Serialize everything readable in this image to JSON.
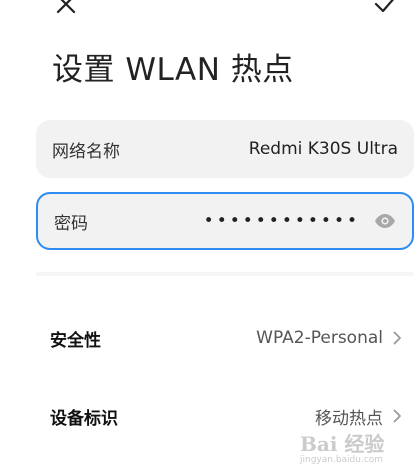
{
  "header": {
    "close_icon": "close-icon",
    "confirm_icon": "check-icon",
    "title": "设置 WLAN 热点"
  },
  "ssid": {
    "label": "网络名称",
    "value": "Redmi K30S Ultra"
  },
  "password": {
    "label": "密码",
    "value": "••••••••••••",
    "toggle_icon": "eye-icon"
  },
  "settings": {
    "security": {
      "label": "安全性",
      "value": "WPA2-Personal"
    },
    "device_id": {
      "label": "设备标识",
      "value": "移动热点"
    }
  },
  "watermark": {
    "text": "Bai 经验",
    "sub": "jingyan.baidu.com"
  },
  "colors": {
    "accent": "#2f8cf0",
    "field_bg": "#f2f2f2"
  }
}
